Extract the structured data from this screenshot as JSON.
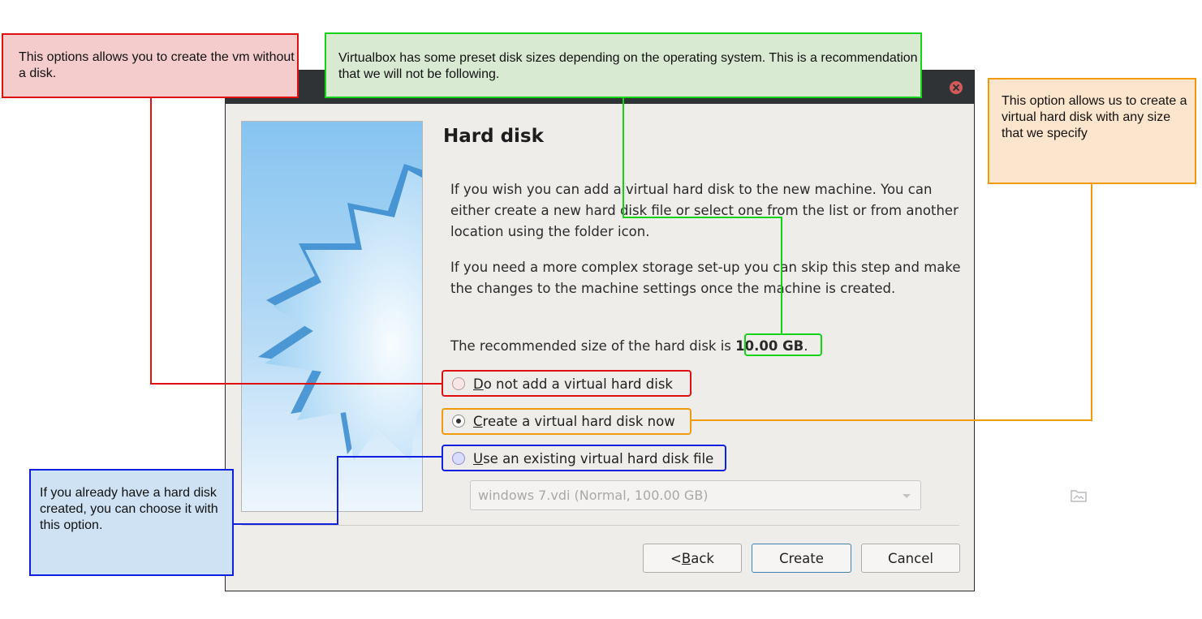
{
  "dialog": {
    "heading": "Hard disk",
    "paragraph1": "If you wish you can add a virtual hard disk to the new machine. You can either create a new hard disk file or select one from the list or from another location using the folder icon.",
    "paragraph2": "If you need a more complex storage set-up you can skip this step and make the changes to the machine settings once the machine is created.",
    "recommended_prefix": "The recommended size of the hard disk is ",
    "recommended_size": "10.00 GB",
    "recommended_suffix": ".",
    "options": [
      {
        "mnemonic": "D",
        "rest": "o not add a virtual hard disk",
        "checked": false
      },
      {
        "mnemonic": "C",
        "rest": "reate a virtual hard disk now",
        "checked": true
      },
      {
        "mnemonic": "U",
        "rest": "se an existing virtual hard disk file",
        "checked": false
      }
    ],
    "disk_select_value": "windows 7.vdi (Normal, 100.00 GB)",
    "buttons": {
      "back_prefix": "< ",
      "back_mnemonic": "B",
      "back_rest": "ack",
      "create": "Create",
      "cancel": "Cancel"
    }
  },
  "annotations": {
    "no_disk": "This options allows you to create the vm without a disk.",
    "preset": "Virtualbox has some preset disk sizes depending on the operating system. This is a recommendation that we will not be following.",
    "create_now": "This option allows us to create a virtual hard disk with any size that we specify",
    "existing": "If you already have a hard disk created, you can choose it with this option."
  },
  "colors": {
    "red": "#e01010",
    "green": "#14d214",
    "orange": "#f39a0a",
    "blue": "#1020e0"
  }
}
